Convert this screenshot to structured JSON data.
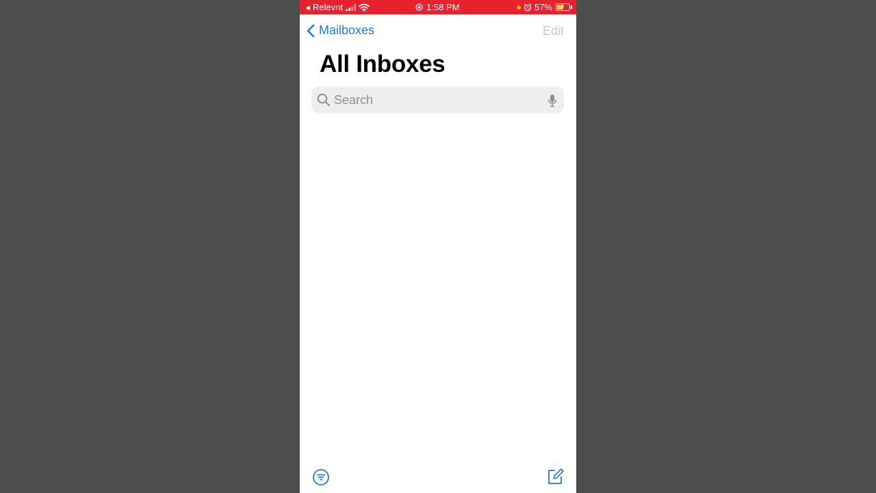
{
  "status_bar": {
    "back_app": "Relevnt",
    "time": "1:58 PM",
    "battery_percent": "57%",
    "battery_level": 0.57
  },
  "nav": {
    "back_label": "Mailboxes",
    "edit_label": "Edit"
  },
  "page": {
    "title": "All Inboxes"
  },
  "search": {
    "placeholder": "Search"
  },
  "colors": {
    "status_bar": "#e8212e",
    "accent": "#1f7fce",
    "disabled": "#c7c7cc"
  },
  "icons": {
    "back": "chevron-left-icon",
    "search": "search-icon",
    "mic": "mic-icon",
    "filter": "filter-icon",
    "compose": "compose-icon"
  }
}
